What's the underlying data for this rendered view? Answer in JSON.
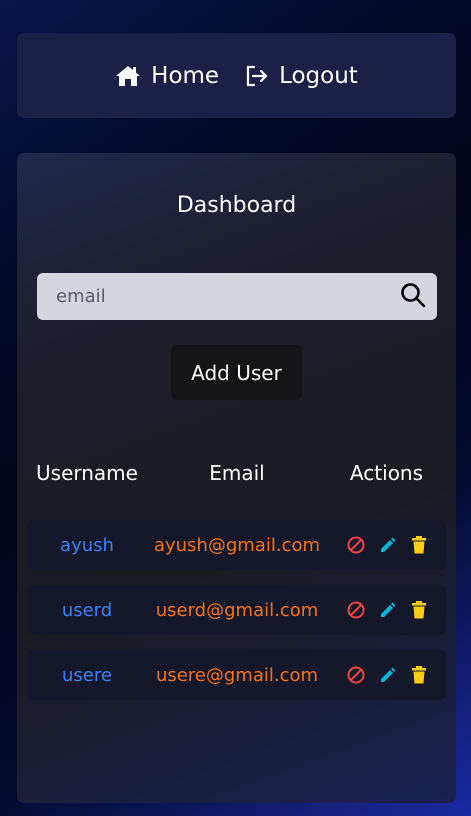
{
  "nav": {
    "home_label": "Home",
    "logout_label": "Logout"
  },
  "dashboard": {
    "title": "Dashboard",
    "search": {
      "placeholder": "email",
      "value": ""
    },
    "add_user_label": "Add User"
  },
  "table": {
    "headers": {
      "username": "Username",
      "email": "Email",
      "actions": "Actions"
    },
    "rows": [
      {
        "username": "ayush",
        "email": "ayush@gmail.com"
      },
      {
        "username": "userd",
        "email": "userd@gmail.com"
      },
      {
        "username": "usere",
        "email": "usere@gmail.com"
      }
    ],
    "action_icons": [
      "block-icon",
      "edit-icon",
      "delete-icon"
    ]
  },
  "colors": {
    "username_link": "#3b82f6",
    "email_text": "#f97316",
    "block_action": "#ef4444",
    "edit_action": "#06b6d4",
    "delete_action": "#facc15"
  }
}
